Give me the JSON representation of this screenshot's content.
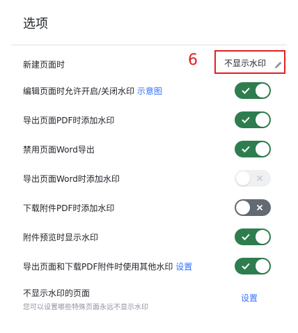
{
  "panel": {
    "title": "选项"
  },
  "annotation": {
    "number": "6"
  },
  "watermark_mode": {
    "label": "新建页面时",
    "value": "不显示水印",
    "edit_icon": "pencil-icon"
  },
  "rows": [
    {
      "label": "编辑页面时允许开启/关闭水印",
      "link": "示意图",
      "state": "on"
    },
    {
      "label": "导出页面PDF时添加水印",
      "state": "on"
    },
    {
      "label": "禁用页面Word导出",
      "state": "on"
    },
    {
      "label": "导出页面Word时添加水印",
      "state": "off-disabled"
    },
    {
      "label": "下载附件PDF时添加水印",
      "state": "off"
    },
    {
      "label": "附件预览时显示水印",
      "state": "on"
    },
    {
      "label": "导出页面和下载PDF附件时使用其他水印",
      "link": "设置",
      "state": "on"
    }
  ],
  "exclude_pages": {
    "label": "不显示水印的页面",
    "description": "您可以设置哪些特殊页面永远不显示水印",
    "action": "设置"
  },
  "colors": {
    "toggle_on": "#2e7d4f",
    "toggle_off": "#646a73",
    "link": "#3370ff",
    "highlight": "#e02020"
  }
}
